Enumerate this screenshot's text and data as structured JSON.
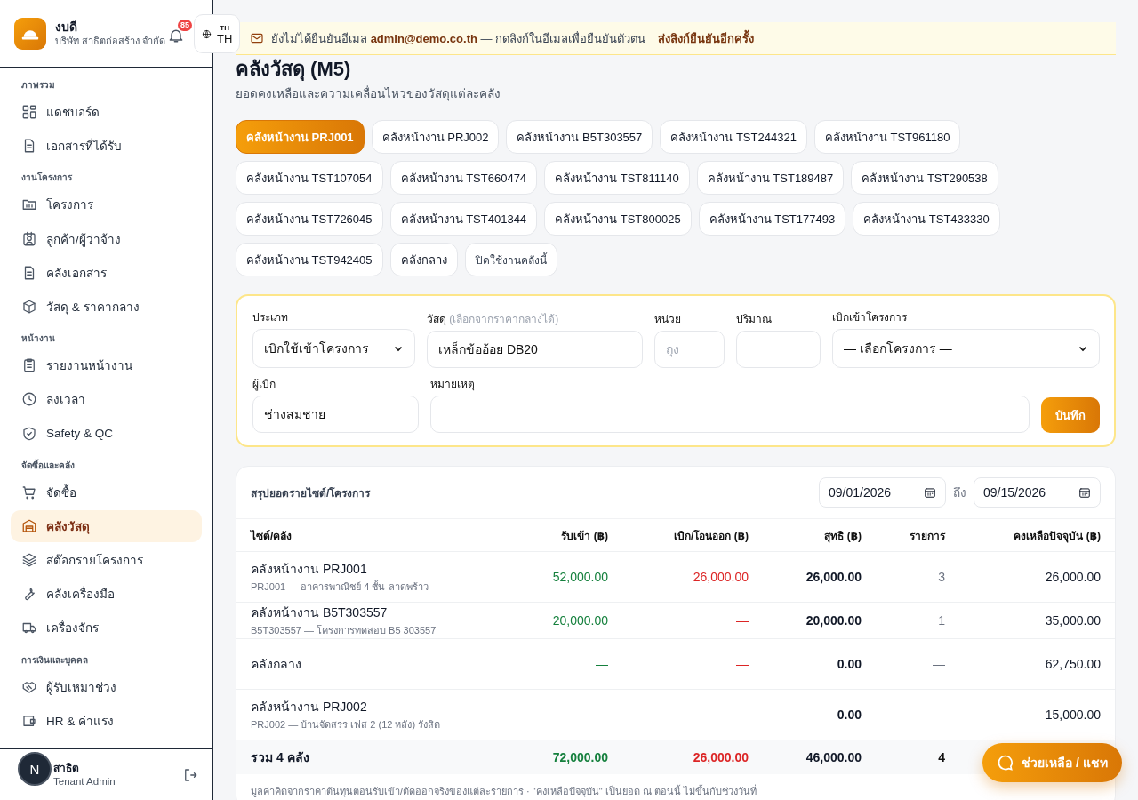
{
  "sidebar": {
    "brand": {
      "name": "งบดี",
      "subtitle": "บริษัท สาธิตก่อสร้าง จำกัด"
    },
    "notification_count": "85",
    "language": {
      "code": "TH",
      "label": "TH"
    },
    "sections": [
      {
        "title": "ภาพรวม",
        "items": [
          {
            "label": "แดชบอร์ด",
            "selected": false
          },
          {
            "label": "เอกสารที่ได้รับ",
            "selected": false
          }
        ]
      },
      {
        "title": "งานโครงการ",
        "items": [
          {
            "label": "โครงการ",
            "selected": false
          },
          {
            "label": "ลูกค้า/ผู้ว่าจ้าง",
            "selected": false
          },
          {
            "label": "คลังเอกสาร",
            "selected": false
          },
          {
            "label": "วัสดุ & ราคากลาง",
            "selected": false
          }
        ]
      },
      {
        "title": "หน้างาน",
        "items": [
          {
            "label": "รายงานหน้างาน",
            "selected": false
          },
          {
            "label": "ลงเวลา",
            "selected": false
          },
          {
            "label": "Safety & QC",
            "selected": false
          }
        ]
      },
      {
        "title": "จัดซื้อและคลัง",
        "items": [
          {
            "label": "จัดซื้อ",
            "selected": false
          },
          {
            "label": "คลังวัสดุ",
            "selected": true
          },
          {
            "label": "สต๊อกรายโครงการ",
            "selected": false
          },
          {
            "label": "คลังเครื่องมือ",
            "selected": false
          },
          {
            "label": "เครื่องจักร",
            "selected": false
          }
        ]
      },
      {
        "title": "การเงินและบุคคล",
        "items": [
          {
            "label": "ผู้รับเหมาช่วง",
            "selected": false
          },
          {
            "label": "HR & ค่าแรง",
            "selected": false
          }
        ]
      }
    ],
    "user": {
      "name": "สาธิต",
      "role": "Tenant Admin",
      "avatar": "N"
    }
  },
  "banner": {
    "message": "ยังไม่ได้ยืนยันอีเมล **admin@demo.co.th** — กดลิงก์ในอีเมลเพื่อยืนยันตัวตน",
    "link": "ส่งลิงก์ยืนยันอีกครั้ง"
  },
  "page": {
    "title": "คลังวัสดุ (M5)",
    "subtitle": "ยอดคงเหลือและความเคลื่อนไหวของวัสดุแต่ละคลัง"
  },
  "warehouses": [
    {
      "label": "คลังหน้างาน PRJ001",
      "kind": "warehouse",
      "selected": true
    },
    {
      "label": "คลังหน้างาน PRJ002",
      "kind": "warehouse",
      "selected": false
    },
    {
      "label": "คลังหน้างาน B5T303557",
      "kind": "warehouse",
      "selected": false
    },
    {
      "label": "คลังหน้างาน TST244321",
      "kind": "warehouse",
      "selected": false
    },
    {
      "label": "คลังหน้างาน TST961180",
      "kind": "warehouse",
      "selected": false
    },
    {
      "label": "คลังหน้างาน TST107054",
      "kind": "warehouse",
      "selected": false
    },
    {
      "label": "คลังหน้างาน TST660474",
      "kind": "warehouse",
      "selected": false
    },
    {
      "label": "คลังหน้างาน TST811140",
      "kind": "warehouse",
      "selected": false
    },
    {
      "label": "คลังหน้างาน TST189487",
      "kind": "warehouse",
      "selected": false
    },
    {
      "label": "คลังหน้างาน TST290538",
      "kind": "warehouse",
      "selected": false
    },
    {
      "label": "คลังหน้างาน TST726045",
      "kind": "warehouse",
      "selected": false
    },
    {
      "label": "คลังหน้างาน TST401344",
      "kind": "warehouse",
      "selected": false
    },
    {
      "label": "คลังหน้างาน TST800025",
      "kind": "warehouse",
      "selected": false
    },
    {
      "label": "คลังหน้างาน TST177493",
      "kind": "warehouse",
      "selected": false
    },
    {
      "label": "คลังหน้างาน TST433330",
      "kind": "warehouse",
      "selected": false
    },
    {
      "label": "คลังหน้างาน TST942405",
      "kind": "warehouse",
      "selected": false
    },
    {
      "label": "คลังกลาง",
      "kind": "warehouse",
      "selected": false
    },
    {
      "label": "ปิดใช้งานคลังนี้",
      "kind": "action",
      "selected": false
    }
  ],
  "form": {
    "fields": [
      {
        "kind": "select",
        "label": "ประเภท",
        "value": "เบิกใช้เข้าโครงการ"
      },
      {
        "kind": "input",
        "label": "วัสดุ",
        "hint": "(เลือกจากราคากลางได้)",
        "value": "เหล็กข้ออ้อย DB20"
      },
      {
        "kind": "input",
        "label": "หน่วย",
        "placeholder": "ถุง"
      },
      {
        "kind": "input",
        "label": "ปริมาณ"
      },
      {
        "kind": "select",
        "label": "เบิกเข้าโครงการ",
        "value": "— เลือกโครงการ —"
      },
      {
        "kind": "input",
        "label": "ผู้เบิก",
        "value": "ช่างสมชาย"
      },
      {
        "kind": "input",
        "label": "หมายเหตุ"
      }
    ],
    "save_button": "บันทึก"
  },
  "summary": {
    "title": "สรุปยอดรายไซต์/โครงการ",
    "date_from": "09/01/2026",
    "to_label": "ถึง",
    "date_to": "09/15/2026",
    "columns": [
      "ไซต์/คลัง",
      "รับเข้า (฿)",
      "เบิก/โอนออก (฿)",
      "สุทธิ (฿)",
      "รายการ",
      "คงเหลือปัจจุบัน (฿)"
    ],
    "rows": [
      {
        "name": "คลังหน้างาน PRJ001",
        "detail": "PRJ001 — อาคารพาณิชย์ 4 ชั้น ลาดพร้าว",
        "received": "52,000.00",
        "issued": "26,000.00",
        "net": "26,000.00",
        "count": "3",
        "balance": "26,000.00"
      },
      {
        "name": "คลังหน้างาน B5T303557",
        "detail": "B5T303557 — โครงการทดสอบ B5 303557",
        "received": "20,000.00",
        "issued": "—",
        "net": "20,000.00",
        "count": "1",
        "balance": "35,000.00"
      },
      {
        "name": "คลังกลาง",
        "received": "—",
        "issued": "—",
        "net": "0.00",
        "count": "—",
        "balance": "62,750.00"
      },
      {
        "name": "คลังหน้างาน PRJ002",
        "detail": "PRJ002 — บ้านจัดสรร เฟส 2 (12 หลัง) รังสิต",
        "received": "—",
        "issued": "—",
        "net": "0.00",
        "count": "—",
        "balance": "15,000.00"
      }
    ],
    "total": {
      "name": "รวม 4 คลัง",
      "received": "72,000.00",
      "issued": "26,000.00",
      "net": "46,000.00",
      "count": "4"
    },
    "footnote": "มูลค่าคิดจากราคาต้นทุนตอนรับเข้า/ตัดออกจริงของแต่ละรายการ · \"คงเหลือปัจจุบัน\" เป็นยอด ณ ตอนนี้ ไม่ขึ้นกับช่วงวันที่"
  },
  "chat_button": "ช่วยเหลือ / แชท"
}
